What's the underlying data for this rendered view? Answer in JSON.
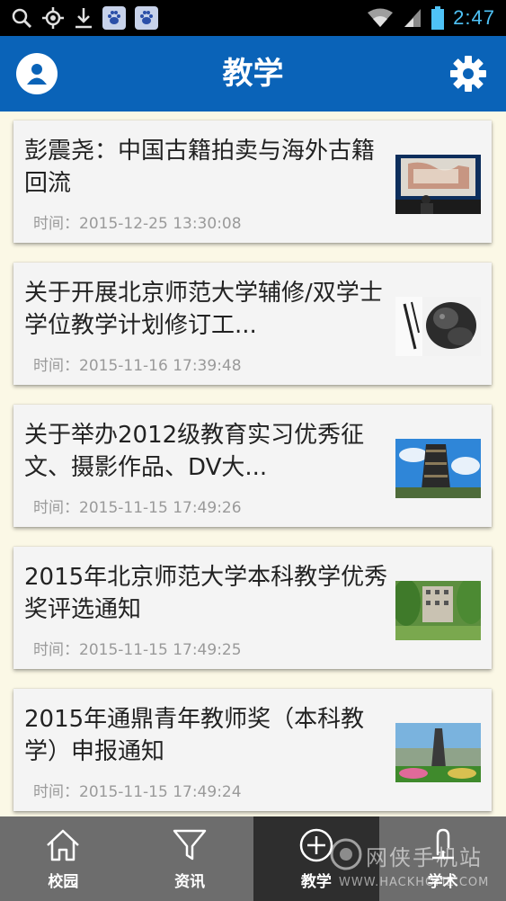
{
  "status_bar": {
    "time": "2:47",
    "icons": [
      "search-icon",
      "location-icon",
      "download-icon",
      "baidu-icon",
      "baidu-icon",
      "wifi-icon",
      "signal-icon",
      "battery-icon"
    ]
  },
  "header": {
    "title": "教学",
    "left_icon": "user-icon",
    "right_icon": "gear-icon",
    "color": "#0a63b8"
  },
  "articles": [
    {
      "title": "彭震尧：中国古籍拍卖与海外古籍回流",
      "time": "时间：2015-12-25 13:30:08",
      "thumb": "lecture-photo"
    },
    {
      "title": "关于开展北京师范大学辅修/双学士学位教学计划修订工...",
      "time": "时间：2015-11-16 17:39:48",
      "thumb": "stone-lion-photo"
    },
    {
      "title": "关于举办2012级教育实习优秀征文、摄影作品、DV大...",
      "time": "时间：2015-11-15 17:49:26",
      "thumb": "tower-photo"
    },
    {
      "title": "2015年北京师范大学本科教学优秀奖评选通知",
      "time": "时间：2015-11-15 17:49:25",
      "thumb": "campus-building-photo"
    },
    {
      "title": "2015年通鼎青年教师奖（本科教学）申报通知",
      "time": "时间：2015-11-15 17:49:24",
      "thumb": "campus-tower-photo"
    }
  ],
  "bottom_nav": [
    {
      "label": "校园",
      "icon": "home-icon",
      "active": false
    },
    {
      "label": "资讯",
      "icon": "filter-icon",
      "active": false
    },
    {
      "label": "教学",
      "icon": "plus-circle-icon",
      "active": true
    },
    {
      "label": "学术",
      "icon": "lamp-icon",
      "active": false
    }
  ],
  "watermark": {
    "cn": "网侠手机站",
    "en": "WWW.HACKHOME.COM"
  }
}
